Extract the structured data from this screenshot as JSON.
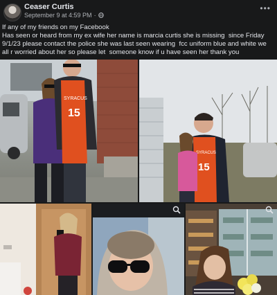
{
  "post": {
    "author": "Ceaser Curtis",
    "timestamp": "September 9 at 4:59 PM",
    "separator": "·",
    "privacy_icon": "globe-icon",
    "more_label": "•••",
    "text": "If any of my friends on my Facebook\nHas seen or heard from my ex wife her name is marcia curtis she is missing  since Friday 9/1/23 please contact the police she was last seen wearing  fcc uniform blue and white we all r worried about her so please let  someone know if u have seen her thank you"
  },
  "photos": [
    {
      "jersey_text": "SYRACUS",
      "jersey_number": "15"
    },
    {
      "jersey_text": "SYRACUS",
      "jersey_number": "15"
    },
    {},
    {},
    {}
  ],
  "colors": {
    "background": "#18191a",
    "text_primary": "#e4e6eb",
    "text_secondary": "#b0b3b8",
    "jersey": "#e0501f"
  }
}
